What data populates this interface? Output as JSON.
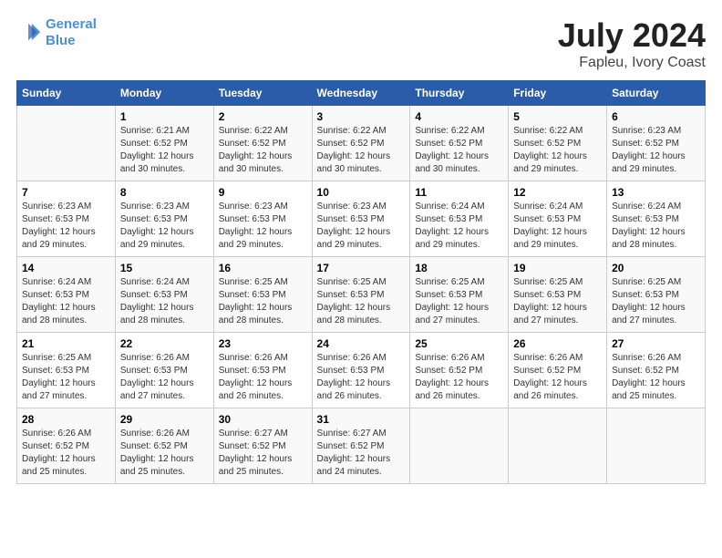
{
  "app": {
    "logo_line1": "General",
    "logo_line2": "Blue",
    "title": "July 2024",
    "subtitle": "Fapleu, Ivory Coast"
  },
  "calendar": {
    "headers": [
      "Sunday",
      "Monday",
      "Tuesday",
      "Wednesday",
      "Thursday",
      "Friday",
      "Saturday"
    ],
    "weeks": [
      [
        {
          "day": "",
          "sunrise": "",
          "sunset": "",
          "daylight": ""
        },
        {
          "day": "1",
          "sunrise": "Sunrise: 6:21 AM",
          "sunset": "Sunset: 6:52 PM",
          "daylight": "Daylight: 12 hours and 30 minutes."
        },
        {
          "day": "2",
          "sunrise": "Sunrise: 6:22 AM",
          "sunset": "Sunset: 6:52 PM",
          "daylight": "Daylight: 12 hours and 30 minutes."
        },
        {
          "day": "3",
          "sunrise": "Sunrise: 6:22 AM",
          "sunset": "Sunset: 6:52 PM",
          "daylight": "Daylight: 12 hours and 30 minutes."
        },
        {
          "day": "4",
          "sunrise": "Sunrise: 6:22 AM",
          "sunset": "Sunset: 6:52 PM",
          "daylight": "Daylight: 12 hours and 30 minutes."
        },
        {
          "day": "5",
          "sunrise": "Sunrise: 6:22 AM",
          "sunset": "Sunset: 6:52 PM",
          "daylight": "Daylight: 12 hours and 29 minutes."
        },
        {
          "day": "6",
          "sunrise": "Sunrise: 6:23 AM",
          "sunset": "Sunset: 6:52 PM",
          "daylight": "Daylight: 12 hours and 29 minutes."
        }
      ],
      [
        {
          "day": "7",
          "sunrise": "Sunrise: 6:23 AM",
          "sunset": "Sunset: 6:53 PM",
          "daylight": "Daylight: 12 hours and 29 minutes."
        },
        {
          "day": "8",
          "sunrise": "Sunrise: 6:23 AM",
          "sunset": "Sunset: 6:53 PM",
          "daylight": "Daylight: 12 hours and 29 minutes."
        },
        {
          "day": "9",
          "sunrise": "Sunrise: 6:23 AM",
          "sunset": "Sunset: 6:53 PM",
          "daylight": "Daylight: 12 hours and 29 minutes."
        },
        {
          "day": "10",
          "sunrise": "Sunrise: 6:23 AM",
          "sunset": "Sunset: 6:53 PM",
          "daylight": "Daylight: 12 hours and 29 minutes."
        },
        {
          "day": "11",
          "sunrise": "Sunrise: 6:24 AM",
          "sunset": "Sunset: 6:53 PM",
          "daylight": "Daylight: 12 hours and 29 minutes."
        },
        {
          "day": "12",
          "sunrise": "Sunrise: 6:24 AM",
          "sunset": "Sunset: 6:53 PM",
          "daylight": "Daylight: 12 hours and 29 minutes."
        },
        {
          "day": "13",
          "sunrise": "Sunrise: 6:24 AM",
          "sunset": "Sunset: 6:53 PM",
          "daylight": "Daylight: 12 hours and 28 minutes."
        }
      ],
      [
        {
          "day": "14",
          "sunrise": "Sunrise: 6:24 AM",
          "sunset": "Sunset: 6:53 PM",
          "daylight": "Daylight: 12 hours and 28 minutes."
        },
        {
          "day": "15",
          "sunrise": "Sunrise: 6:24 AM",
          "sunset": "Sunset: 6:53 PM",
          "daylight": "Daylight: 12 hours and 28 minutes."
        },
        {
          "day": "16",
          "sunrise": "Sunrise: 6:25 AM",
          "sunset": "Sunset: 6:53 PM",
          "daylight": "Daylight: 12 hours and 28 minutes."
        },
        {
          "day": "17",
          "sunrise": "Sunrise: 6:25 AM",
          "sunset": "Sunset: 6:53 PM",
          "daylight": "Daylight: 12 hours and 28 minutes."
        },
        {
          "day": "18",
          "sunrise": "Sunrise: 6:25 AM",
          "sunset": "Sunset: 6:53 PM",
          "daylight": "Daylight: 12 hours and 27 minutes."
        },
        {
          "day": "19",
          "sunrise": "Sunrise: 6:25 AM",
          "sunset": "Sunset: 6:53 PM",
          "daylight": "Daylight: 12 hours and 27 minutes."
        },
        {
          "day": "20",
          "sunrise": "Sunrise: 6:25 AM",
          "sunset": "Sunset: 6:53 PM",
          "daylight": "Daylight: 12 hours and 27 minutes."
        }
      ],
      [
        {
          "day": "21",
          "sunrise": "Sunrise: 6:25 AM",
          "sunset": "Sunset: 6:53 PM",
          "daylight": "Daylight: 12 hours and 27 minutes."
        },
        {
          "day": "22",
          "sunrise": "Sunrise: 6:26 AM",
          "sunset": "Sunset: 6:53 PM",
          "daylight": "Daylight: 12 hours and 27 minutes."
        },
        {
          "day": "23",
          "sunrise": "Sunrise: 6:26 AM",
          "sunset": "Sunset: 6:53 PM",
          "daylight": "Daylight: 12 hours and 26 minutes."
        },
        {
          "day": "24",
          "sunrise": "Sunrise: 6:26 AM",
          "sunset": "Sunset: 6:53 PM",
          "daylight": "Daylight: 12 hours and 26 minutes."
        },
        {
          "day": "25",
          "sunrise": "Sunrise: 6:26 AM",
          "sunset": "Sunset: 6:52 PM",
          "daylight": "Daylight: 12 hours and 26 minutes."
        },
        {
          "day": "26",
          "sunrise": "Sunrise: 6:26 AM",
          "sunset": "Sunset: 6:52 PM",
          "daylight": "Daylight: 12 hours and 26 minutes."
        },
        {
          "day": "27",
          "sunrise": "Sunrise: 6:26 AM",
          "sunset": "Sunset: 6:52 PM",
          "daylight": "Daylight: 12 hours and 25 minutes."
        }
      ],
      [
        {
          "day": "28",
          "sunrise": "Sunrise: 6:26 AM",
          "sunset": "Sunset: 6:52 PM",
          "daylight": "Daylight: 12 hours and 25 minutes."
        },
        {
          "day": "29",
          "sunrise": "Sunrise: 6:26 AM",
          "sunset": "Sunset: 6:52 PM",
          "daylight": "Daylight: 12 hours and 25 minutes."
        },
        {
          "day": "30",
          "sunrise": "Sunrise: 6:27 AM",
          "sunset": "Sunset: 6:52 PM",
          "daylight": "Daylight: 12 hours and 25 minutes."
        },
        {
          "day": "31",
          "sunrise": "Sunrise: 6:27 AM",
          "sunset": "Sunset: 6:52 PM",
          "daylight": "Daylight: 12 hours and 24 minutes."
        },
        {
          "day": "",
          "sunrise": "",
          "sunset": "",
          "daylight": ""
        },
        {
          "day": "",
          "sunrise": "",
          "sunset": "",
          "daylight": ""
        },
        {
          "day": "",
          "sunrise": "",
          "sunset": "",
          "daylight": ""
        }
      ]
    ]
  }
}
